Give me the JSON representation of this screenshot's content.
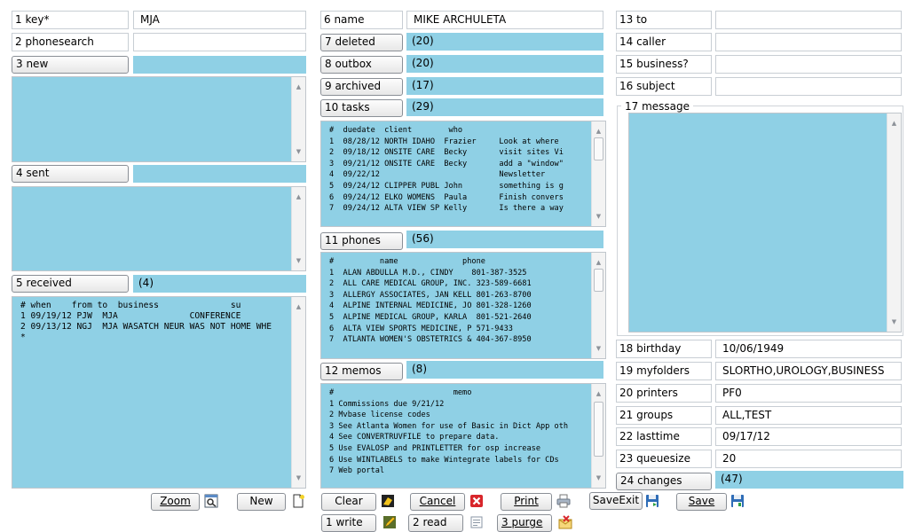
{
  "fields": {
    "key_label": "1 key*",
    "key_value": "MJA",
    "phonesearch_label": "2 phonesearch",
    "phonesearch_value": "",
    "name_label": "6 name",
    "name_value": "MIKE ARCHULETA",
    "to_label": "13 to",
    "to_value": "",
    "caller_label": "14 caller",
    "caller_value": "",
    "business_label": "15 business?",
    "business_value": "",
    "subject_label": "16 subject",
    "subject_value": "",
    "message_label": "17 message",
    "birthday_label": "18 birthday",
    "birthday_value": "10/06/1949",
    "myfolders_label": "19 myfolders",
    "myfolders_value": "SLORTHO,UROLOGY,BUSINESS",
    "printers_label": "20 printers",
    "printers_value": "PF0",
    "groups_label": "21 groups",
    "groups_value": "ALL,TEST",
    "lasttime_label": "22 lasttime",
    "lasttime_value": "09/17/12",
    "queuesize_label": "23 queuesize",
    "queuesize_value": "20"
  },
  "sections": {
    "new_label": "3 new",
    "new_count": "",
    "sent_label": "4 sent",
    "sent_count": "",
    "received_label": "5 received",
    "received_count": "(4)",
    "deleted_label": "7 deleted",
    "deleted_count": "(20)",
    "outbox_label": "8 outbox",
    "outbox_count": "(20)",
    "archived_label": "9 archived",
    "archived_count": "(17)",
    "tasks_label": "10 tasks",
    "tasks_count": "(29)",
    "phones_label": "11 phones",
    "phones_count": "(56)",
    "memos_label": "12 memos",
    "memos_count": "(8)",
    "changes_label": "24 changes",
    "changes_count": "(47)"
  },
  "lists": {
    "received_text": "# when    from to  business              su\n1 09/19/12 PJW  MJA              CONFERENCE\n2 09/13/12 NGJ  MJA WASATCH NEUR WAS NOT HOME WHE\n*",
    "tasks_text": "#  duedate  client        who\n1  08/28/12 NORTH IDAHO  Frazier     Look at where\n2  09/18/12 ONSITE CARE  Becky       visit sites Vi\n3  09/21/12 ONSITE CARE  Becky       add a \"window\"\n4  09/22/12                          Newsletter\n5  09/24/12 CLIPPER PUBL John        something is g\n6  09/24/12 ELKO WOMENS  Paula       Finish convers\n7  09/24/12 ALTA VIEW SP Kelly       Is there a way",
    "phones_text": "#          name              phone\n1  ALAN ABDULLA M.D., CINDY    801-387-3525\n2  ALL CARE MEDICAL GROUP, INC. 323-589-6681\n3  ALLERGY ASSOCIATES, JAN KELL 801-263-8700\n4  ALPINE INTERNAL MEDICINE, JO 801-328-1260\n5  ALPINE MEDICAL GROUP, KARLA  801-521-2640\n6  ALTA VIEW SPORTS MEDICINE, P 571-9433\n7  ATLANTA WOMEN'S OBSTETRICS & 404-367-8950",
    "memos_text": "#                          memo\n1 Commissions due 9/21/12\n2 Mvbase license codes\n3 See Atlanta Women for use of Basic in Dict App oth\n4 See CONVERTRUVFILE to prepare data.\n5 Use EVALOSP and PRINTLETTER for osp increase\n6 Use WINTLABELS to make Wintegrate labels for CDs\n7 Web portal"
  },
  "buttons": {
    "zoom": "Zoom",
    "new": "New",
    "clear": "Clear",
    "cancel": "Cancel",
    "print": "Print",
    "saveexit": "SaveExit",
    "save": "Save",
    "write": "1 write",
    "read": "2 read",
    "purge": "3 purge"
  },
  "icons": {
    "zoom": "zoom-window-icon",
    "new": "new-document-icon",
    "clear": "eraser-icon",
    "cancel": "red-x-icon",
    "print": "printer-icon",
    "saveexit": "floppy-exit-icon",
    "save": "floppy-icon",
    "write": "write-pencil-icon",
    "read": "read-document-icon",
    "purge": "purge-envelope-icon"
  },
  "colors": {
    "accent": "#8fd0e5",
    "cancel_red": "#d8262b"
  }
}
